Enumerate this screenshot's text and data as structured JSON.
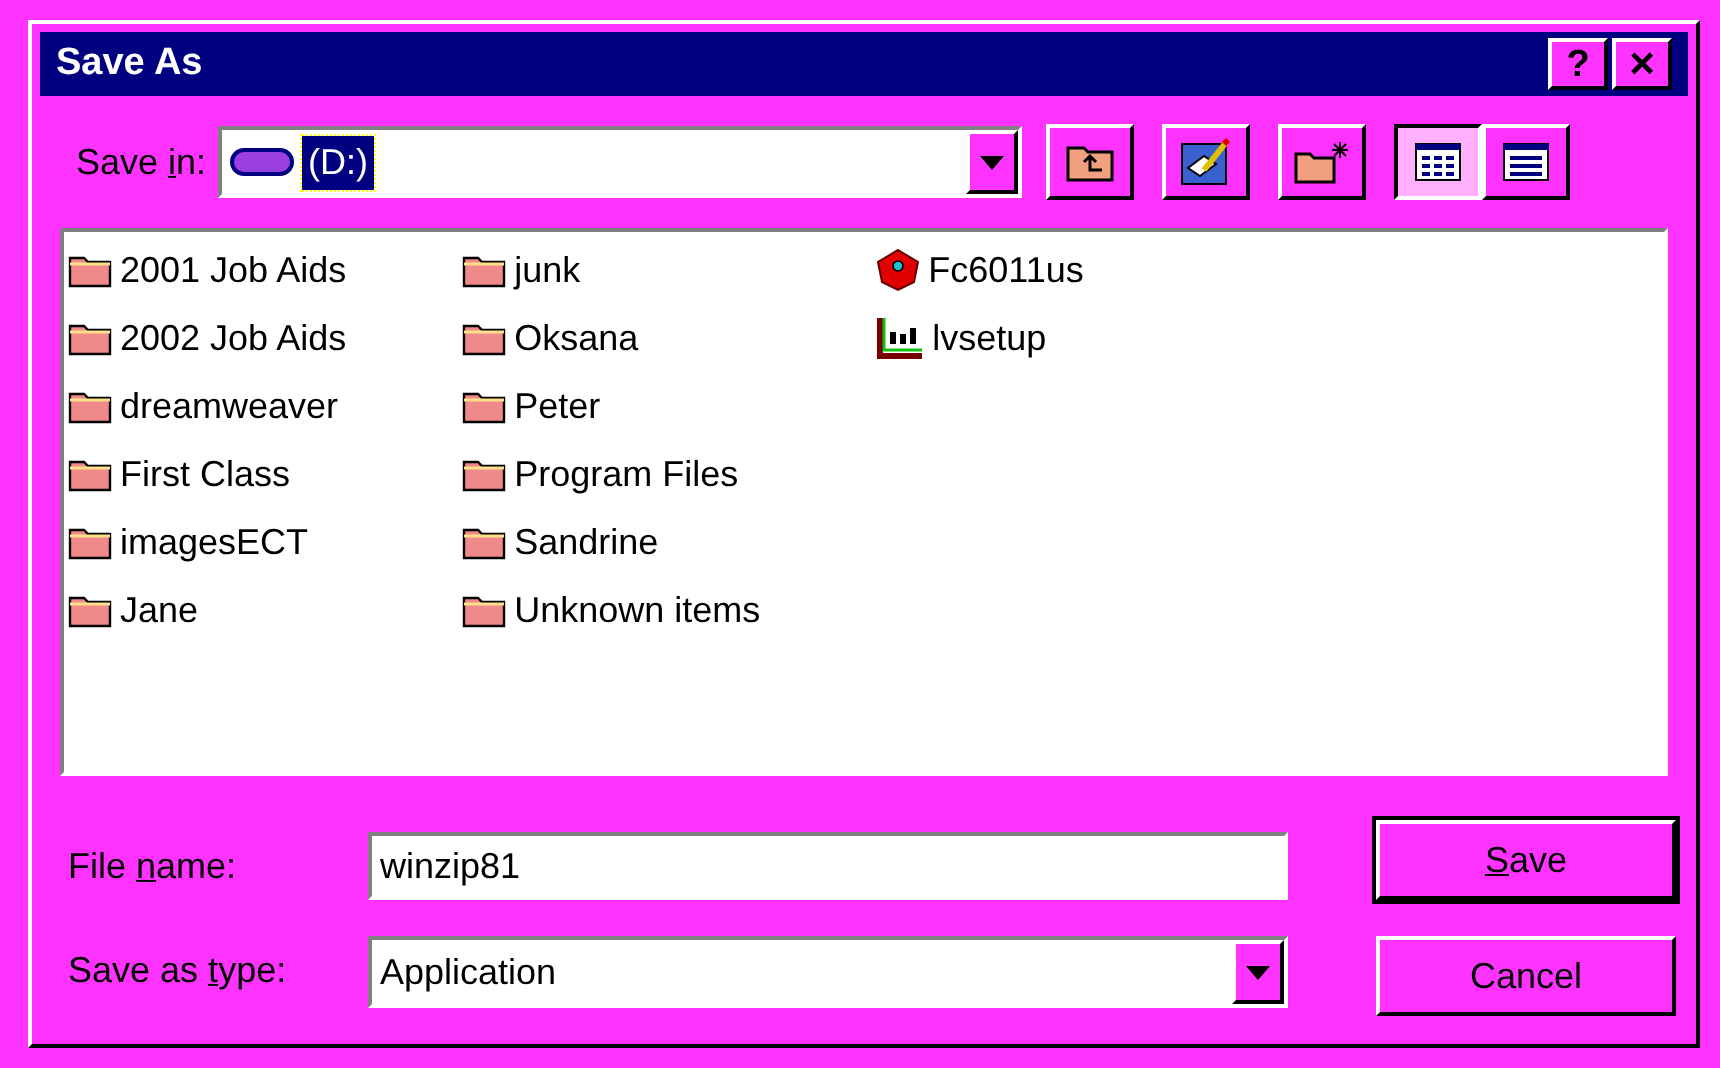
{
  "window": {
    "title": "Save As",
    "help_button": "?",
    "close_button": "×"
  },
  "save_in": {
    "label": {
      "pre": "Save ",
      "key": "i",
      "post": "n:"
    },
    "value": "(D:)"
  },
  "toolbar": [
    {
      "kind": "up-folder"
    },
    {
      "kind": "desktop"
    },
    {
      "kind": "new-folder"
    }
  ],
  "view_buttons": [
    {
      "kind": "list",
      "selected": true
    },
    {
      "kind": "details",
      "selected": false
    }
  ],
  "files": [
    {
      "name": "2001 Job Aids",
      "kind": "folder"
    },
    {
      "name": "2002 Job Aids",
      "kind": "folder"
    },
    {
      "name": "dreamweaver",
      "kind": "folder"
    },
    {
      "name": "First Class",
      "kind": "folder"
    },
    {
      "name": "imagesECT",
      "kind": "folder"
    },
    {
      "name": "Jane",
      "kind": "folder"
    },
    {
      "name": "junk",
      "kind": "folder"
    },
    {
      "name": "Oksana",
      "kind": "folder"
    },
    {
      "name": "Peter",
      "kind": "folder"
    },
    {
      "name": "Program Files",
      "kind": "folder"
    },
    {
      "name": "Sandrine",
      "kind": "folder"
    },
    {
      "name": "Unknown items",
      "kind": "folder"
    },
    {
      "name": "Fc6011us",
      "kind": "box-app"
    },
    {
      "name": "lvsetup",
      "kind": "chart-app"
    }
  ],
  "file_name": {
    "label": {
      "pre": "File ",
      "key": "n",
      "post": "ame:"
    },
    "value": "winzip81"
  },
  "save_as_type": {
    "label": {
      "pre": "Save as ",
      "key": "t",
      "post": "ype:"
    },
    "value": "Application"
  },
  "buttons": [
    {
      "label": {
        "key": "S",
        "post": "ave"
      },
      "default": true
    },
    {
      "label": {
        "pre": "Cancel"
      },
      "default": false
    }
  ]
}
